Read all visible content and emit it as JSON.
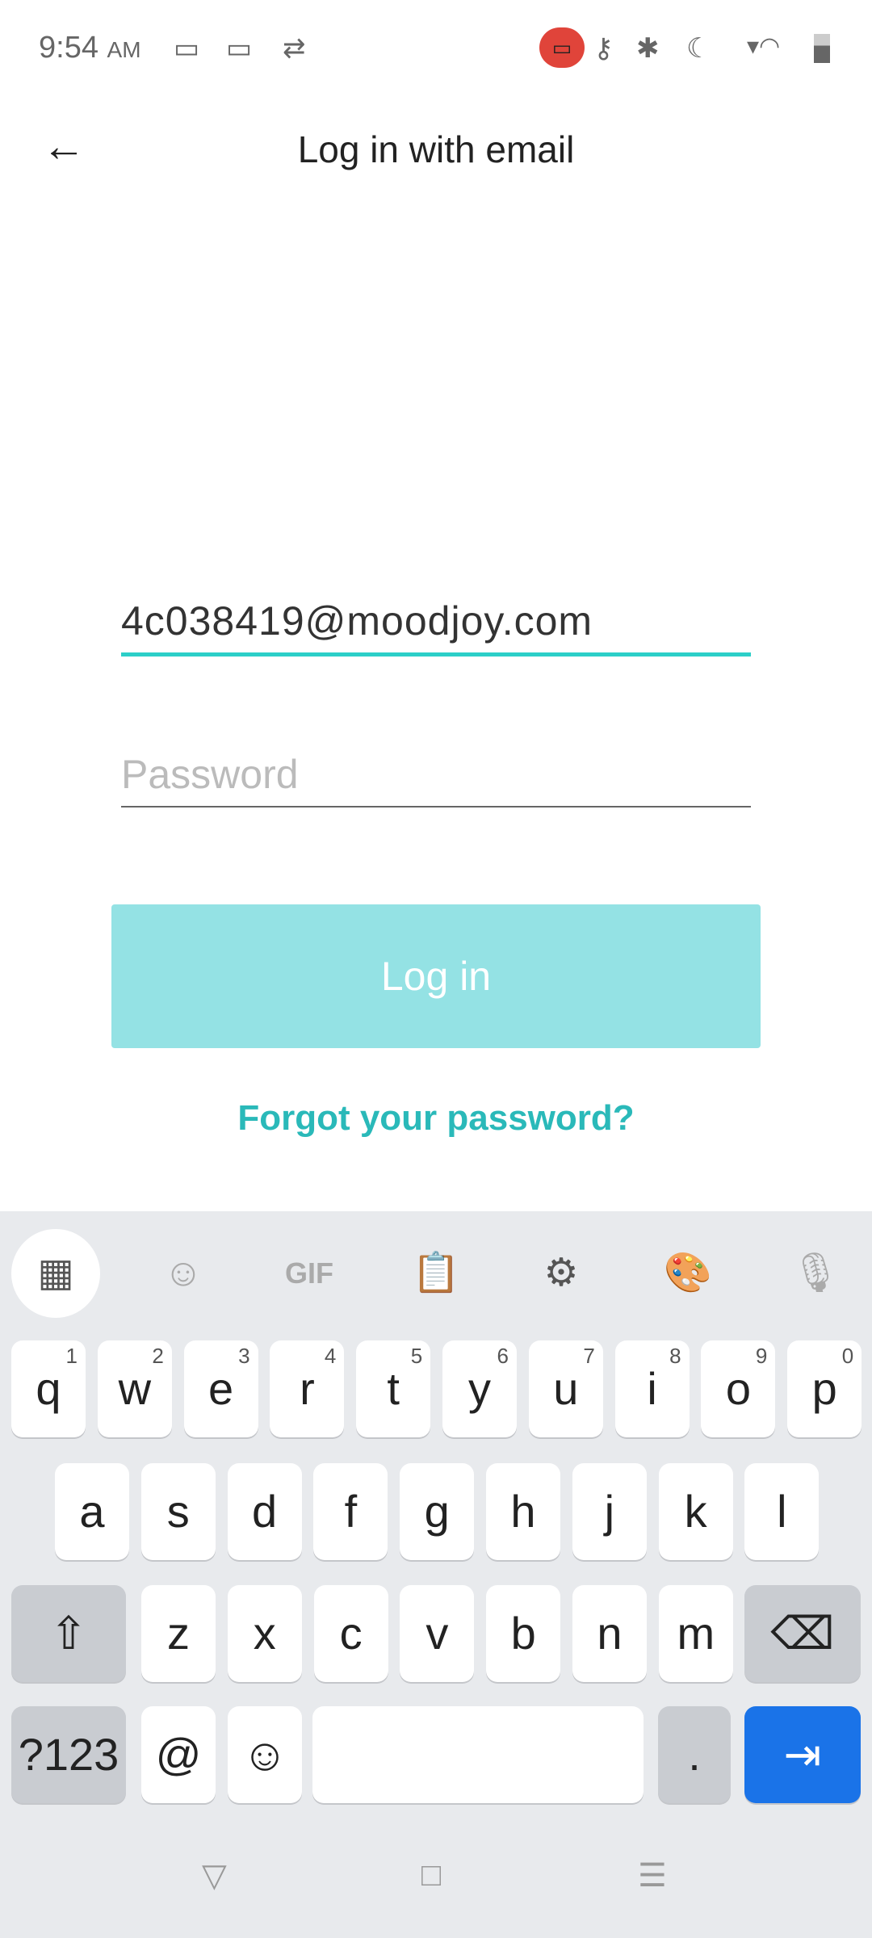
{
  "status": {
    "time": "9:54",
    "ampm": "AM",
    "icons": [
      "video-icon",
      "video-icon",
      "sync-icon",
      "screen-record-icon",
      "vpn-key-icon",
      "bluetooth-icon",
      "do-not-disturb-moon-icon",
      "wifi-icon",
      "battery-icon"
    ]
  },
  "header": {
    "title": "Log in with email",
    "back_icon": "arrow-left-icon"
  },
  "form": {
    "email_value": "4c038419@moodjoy.com",
    "password_placeholder": "Password",
    "login_label": "Log in",
    "forgot_label": "Forgot your password?"
  },
  "colors": {
    "accent": "#2ccfc8",
    "button_disabled": "#94e2e4",
    "link": "#2ab9b9",
    "enter_key": "#1a73e8"
  },
  "keyboard": {
    "toolbar": [
      "apps-grid-icon",
      "sticker-icon",
      "GIF",
      "clipboard-icon",
      "settings-icon",
      "palette-icon",
      "mic-icon"
    ],
    "row1": [
      [
        "q",
        "1"
      ],
      [
        "w",
        "2"
      ],
      [
        "e",
        "3"
      ],
      [
        "r",
        "4"
      ],
      [
        "t",
        "5"
      ],
      [
        "y",
        "6"
      ],
      [
        "u",
        "7"
      ],
      [
        "i",
        "8"
      ],
      [
        "o",
        "9"
      ],
      [
        "p",
        "0"
      ]
    ],
    "row2": [
      "a",
      "s",
      "d",
      "f",
      "g",
      "h",
      "j",
      "k",
      "l"
    ],
    "row3": [
      "z",
      "x",
      "c",
      "v",
      "b",
      "n",
      "m"
    ],
    "symbols": "?123",
    "at": "@",
    "period": ".",
    "emoji": "☺",
    "shift": "⇧",
    "backspace": "⌫",
    "enter": "⇥"
  },
  "navbar": {
    "back": "▽",
    "home": "□",
    "recents": "☰"
  }
}
